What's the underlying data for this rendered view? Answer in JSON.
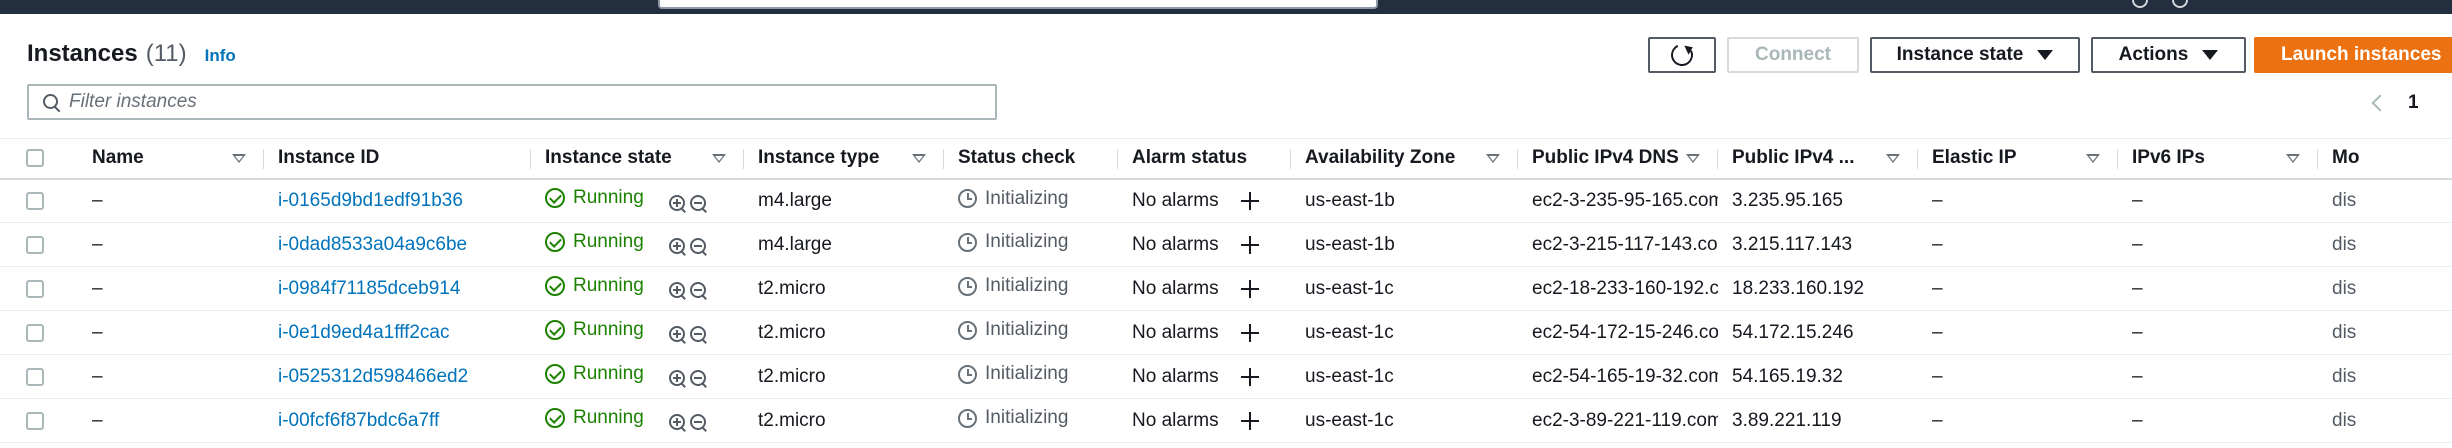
{
  "header": {
    "title": "Instances",
    "count": "(11)",
    "info_link": "Info"
  },
  "toolbar": {
    "connect_label": "Connect",
    "instance_state_label": "Instance state",
    "actions_label": "Actions",
    "launch_label": "Launch instances"
  },
  "search": {
    "placeholder": "Filter instances",
    "value": ""
  },
  "pagination": {
    "current_page": "1"
  },
  "table": {
    "columns": [
      "Name",
      "Instance ID",
      "Instance state",
      "Instance type",
      "Status check",
      "Alarm status",
      "Availability Zone",
      "Public IPv4 DNS",
      "Public IPv4 ...",
      "Elastic IP",
      "IPv6 IPs",
      "Mo"
    ],
    "rows": [
      {
        "name": "–",
        "id": "i-0165d9bd1edf91b36",
        "state": "Running",
        "type": "m4.large",
        "status": "Initializing",
        "alarm": "No alarms",
        "az": "us-east-1b",
        "dns": "ec2-3-235-95-165.com...",
        "ipv4": "3.235.95.165",
        "eip": "–",
        "ipv6": "–",
        "mon": "dis"
      },
      {
        "name": "–",
        "id": "i-0dad8533a04a9c6be",
        "state": "Running",
        "type": "m4.large",
        "status": "Initializing",
        "alarm": "No alarms",
        "az": "us-east-1b",
        "dns": "ec2-3-215-117-143.co...",
        "ipv4": "3.215.117.143",
        "eip": "–",
        "ipv6": "–",
        "mon": "dis"
      },
      {
        "name": "–",
        "id": "i-0984f71185dceb914",
        "state": "Running",
        "type": "t2.micro",
        "status": "Initializing",
        "alarm": "No alarms",
        "az": "us-east-1c",
        "dns": "ec2-18-233-160-192.co...",
        "ipv4": "18.233.160.192",
        "eip": "–",
        "ipv6": "–",
        "mon": "dis"
      },
      {
        "name": "–",
        "id": "i-0e1d9ed4a1fff2cac",
        "state": "Running",
        "type": "t2.micro",
        "status": "Initializing",
        "alarm": "No alarms",
        "az": "us-east-1c",
        "dns": "ec2-54-172-15-246.co...",
        "ipv4": "54.172.15.246",
        "eip": "–",
        "ipv6": "–",
        "mon": "dis"
      },
      {
        "name": "–",
        "id": "i-0525312d598466ed2",
        "state": "Running",
        "type": "t2.micro",
        "status": "Initializing",
        "alarm": "No alarms",
        "az": "us-east-1c",
        "dns": "ec2-54-165-19-32.com...",
        "ipv4": "54.165.19.32",
        "eip": "–",
        "ipv6": "–",
        "mon": "dis"
      },
      {
        "name": "–",
        "id": "i-00fcf6f87bdc6a7ff",
        "state": "Running",
        "type": "t2.micro",
        "status": "Initializing",
        "alarm": "No alarms",
        "az": "us-east-1c",
        "dns": "ec2-3-89-221-119.com...",
        "ipv4": "3.89.221.119",
        "eip": "–",
        "ipv6": "–",
        "mon": "dis"
      }
    ]
  },
  "colors": {
    "primary": "#ec7211",
    "link": "#0073bb",
    "running": "#1d8102",
    "nav_bg": "#232f3e"
  },
  "icons": {
    "refresh": "refresh-icon",
    "search": "search-icon",
    "running": "check-circle-icon",
    "initializing": "clock-icon",
    "alarm_add": "plus-icon",
    "zoom_in": "zoom-in-icon",
    "zoom_out": "zoom-out-icon",
    "prev_page": "chevron-left-icon"
  }
}
